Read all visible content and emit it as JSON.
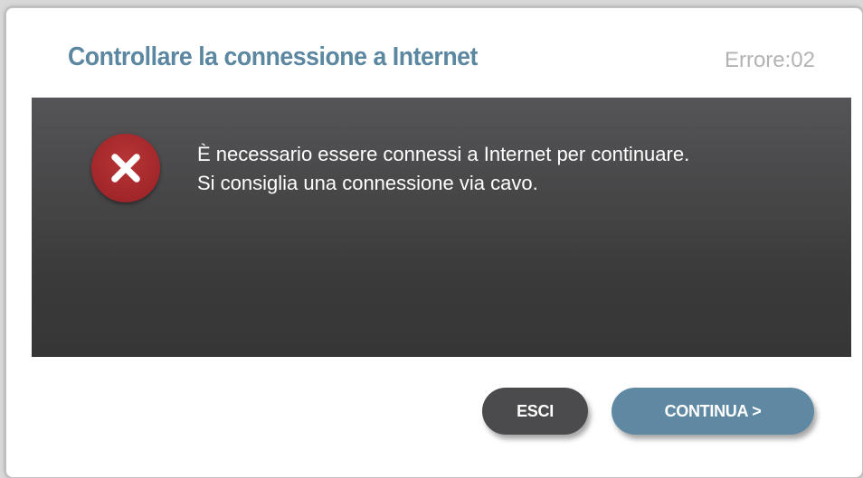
{
  "dialog": {
    "title": "Controllare la connessione a Internet",
    "error_code": "Errore:02",
    "icon": "error-x-icon",
    "message_line1": "È necessario essere connessi a Internet per continuare.",
    "message_line2": "Si consiglia una connessione via cavo."
  },
  "buttons": {
    "exit_label": "ESCI",
    "continue_label": "CONTINUA >"
  },
  "colors": {
    "title": "#5b87a1",
    "error_code": "#b3b3b3",
    "panel": "#444446",
    "error_icon": "#a1262a",
    "exit_button": "#4b4b4d",
    "continue_button": "#5f89a2"
  }
}
